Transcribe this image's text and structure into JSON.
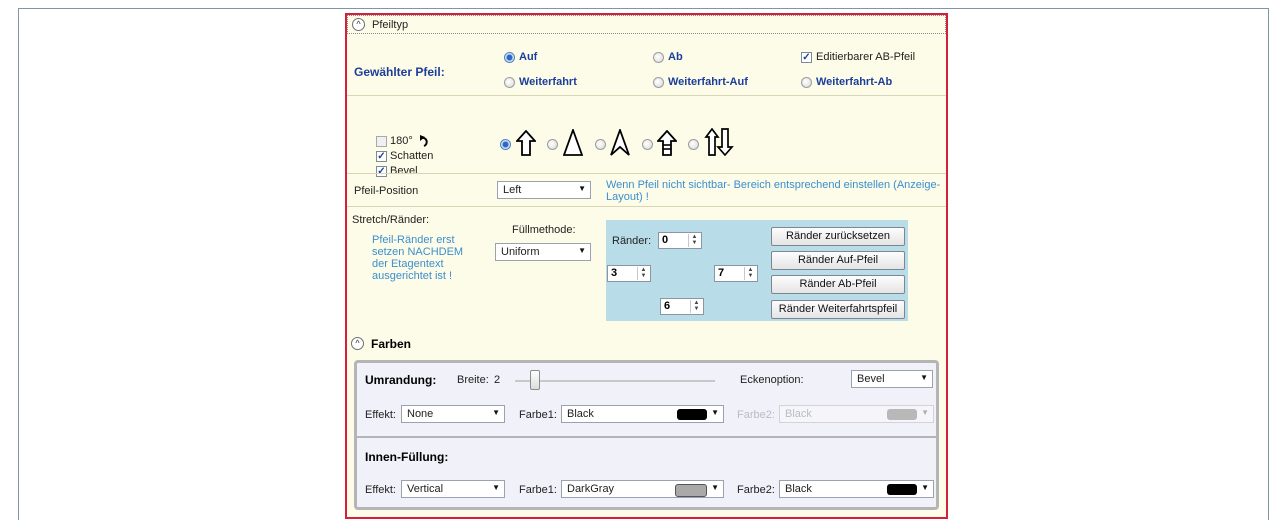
{
  "pfeiltyp": {
    "header_label": "Pfeiltyp",
    "gewaehlter_label": "Gewählter Pfeil:",
    "radios": [
      {
        "label": "Auf",
        "selected": true
      },
      {
        "label": "Ab",
        "selected": false
      },
      {
        "label": "Weiterfahrt",
        "selected": false
      },
      {
        "label": "Weiterfahrt-Auf",
        "selected": false
      },
      {
        "label": "Weiterfahrt-Ab",
        "selected": false
      }
    ],
    "editierbar_label": "Editierbarer AB-Pfeil",
    "editierbar_checked": true,
    "opt_180_label": "180°",
    "opt_180_checked": false,
    "schatten_label": "Schatten",
    "schatten_checked": true,
    "bevel_label": "Bevel",
    "bevel_checked": true,
    "shape_icons": [
      "arrow-up-outline-icon",
      "triangle-outline-icon",
      "chevron-arrow-outline-icon",
      "arrow-up-barred-icon",
      "arrows-up-down-icon"
    ],
    "shape_selected_index": 0,
    "position_label": "Pfeil-Position",
    "position_value": "Left",
    "position_hint": "Wenn Pfeil nicht sichtbar- Bereich entsprechend einstellen (Anzeige-Layout) !",
    "stretch_label": "Stretch/Ränder:",
    "stretch_hint": "Pfeil-Ränder erst setzen NACHDEM der Etagentext ausgerichtet ist !",
    "fuell_label": "Füllmethode:",
    "fuell_value": "Uniform",
    "raender_label": "Ränder:",
    "raender_top": "0",
    "raender_left": "3",
    "raender_right": "7",
    "raender_bottom": "6",
    "buttons": [
      "Ränder zurücksetzen",
      "Ränder Auf-Pfeil",
      "Ränder Ab-Pfeil",
      "Ränder Weiterfahrtspfeil"
    ]
  },
  "farben": {
    "header_label": "Farben",
    "umrandung_label": "Umrandung:",
    "breite_label": "Breite:",
    "breite_value": "2",
    "ecken_label": "Eckenoption:",
    "ecken_value": "Bevel",
    "effekt_label": "Effekt:",
    "effekt_value": "None",
    "farbe1_label": "Farbe1:",
    "farbe1_value": "Black",
    "farbe1_color": "#000000",
    "farbe2_label": "Farbe2:",
    "farbe2_value": "Black",
    "farbe2_color": "#a9a9a9",
    "innen_label": "Innen-Füllung:",
    "innen_effekt_label": "Effekt:",
    "innen_effekt_value": "Vertical",
    "innen_farbe1_label": "Farbe1:",
    "innen_farbe1_value": "DarkGray",
    "innen_farbe1_color": "#a9a9a9",
    "innen_farbe2_label": "Farbe2:",
    "innen_farbe2_value": "Black",
    "innen_farbe2_color": "#000000"
  }
}
